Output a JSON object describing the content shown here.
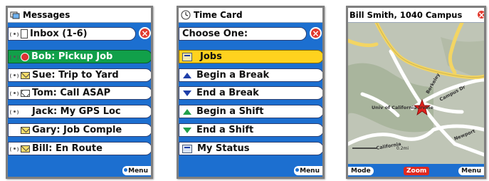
{
  "messages": {
    "title": "Messages",
    "inbox": "Inbox (1-6)",
    "items": [
      {
        "label": "Bob: Pickup Job"
      },
      {
        "label": "Sue: Trip to Yard"
      },
      {
        "label": "Tom: Call ASAP"
      },
      {
        "label": "Jack: My GPS Loc"
      },
      {
        "label": "Gary: Job Comple"
      },
      {
        "label": "Bill: En Route"
      }
    ],
    "menu": "Menu"
  },
  "timecard": {
    "title": "Time Card",
    "prompt": "Choose One:",
    "items": [
      {
        "label": "Jobs"
      },
      {
        "label": "Begin a Break"
      },
      {
        "label": "End a Break"
      },
      {
        "label": "Begin a Shift"
      },
      {
        "label": "End a Shift"
      },
      {
        "label": "My Status"
      }
    ],
    "menu": "Menu"
  },
  "map": {
    "title": "Bill Smith, 1040 Campus",
    "labels": {
      "uni": "Univ of California Irvine",
      "campus": "Campus Dr",
      "berkeley": "Berkeley",
      "newport": "Newport",
      "california": "California",
      "scale": "0.2mi"
    },
    "mode": "Mode",
    "zoom": "Zoom",
    "menu": "Menu"
  },
  "colors": {
    "frame_blue": "#1c6fd0",
    "selected_green": "#11a04a",
    "selected_yellow": "#ffd21e",
    "close_red": "#e23a2e",
    "road_yellow": "#f3d563"
  },
  "close_glyph": "×"
}
